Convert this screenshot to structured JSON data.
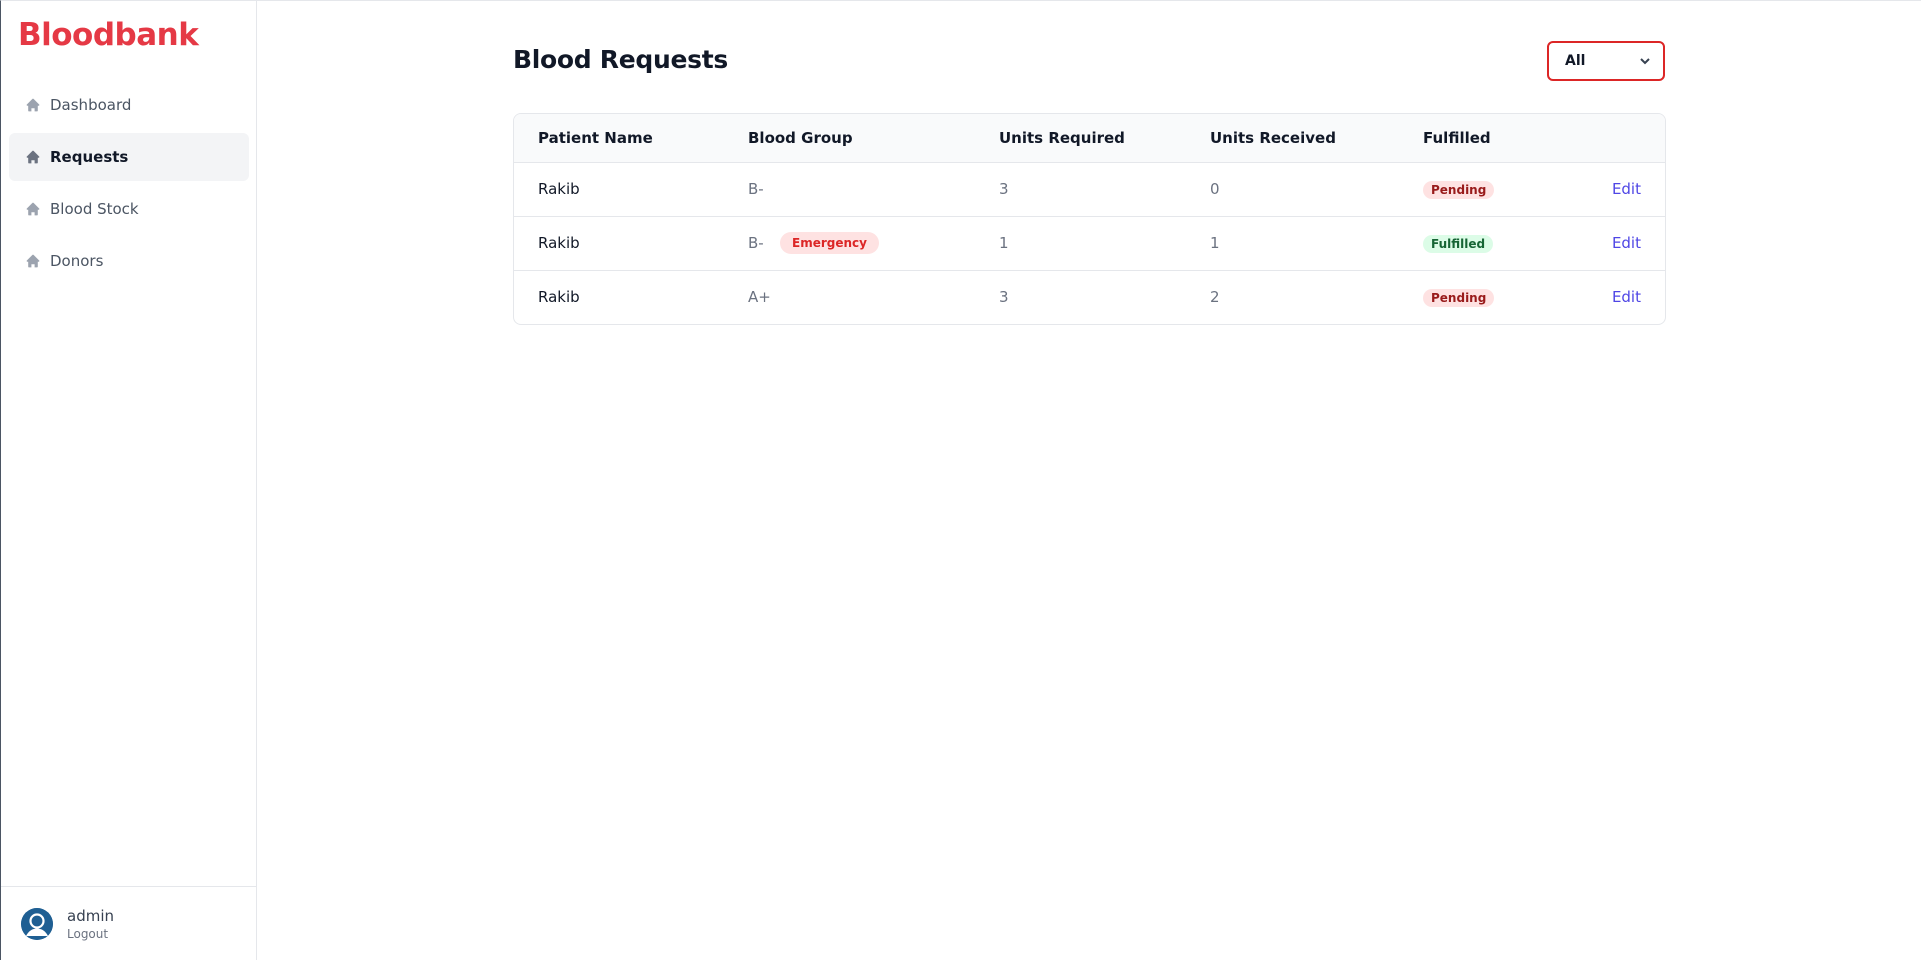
{
  "brand": {
    "name": "Bloodbank",
    "color": "#e53945"
  },
  "sidebar": {
    "items": [
      {
        "label": "Dashboard",
        "icon": "home-icon",
        "active": false
      },
      {
        "label": "Requests",
        "icon": "home-icon",
        "active": true
      },
      {
        "label": "Blood Stock",
        "icon": "home-icon",
        "active": false
      },
      {
        "label": "Donors",
        "icon": "home-icon",
        "active": false
      }
    ]
  },
  "user": {
    "name": "admin",
    "logout_label": "Logout",
    "avatar_color": "#1f5f93"
  },
  "main": {
    "title": "Blood Requests",
    "filter": {
      "selected": "All",
      "icon": "chevron-down-icon",
      "border_color": "#dc2626"
    },
    "table": {
      "headers": [
        "Patient Name",
        "Blood Group",
        "Units Required",
        "Units Received",
        "Fulfilled",
        ""
      ],
      "rows": [
        {
          "patient": "Rakib",
          "blood_group": "B-",
          "emergency": "",
          "units_required": "3",
          "units_received": "0",
          "status": "Pending",
          "status_type": "pending",
          "action": "Edit"
        },
        {
          "patient": "Rakib",
          "blood_group": "B-",
          "emergency": "Emergency",
          "units_required": "1",
          "units_received": "1",
          "status": "Fulfilled",
          "status_type": "fulfilled",
          "action": "Edit"
        },
        {
          "patient": "Rakib",
          "blood_group": "A+",
          "emergency": "",
          "units_required": "3",
          "units_received": "2",
          "status": "Pending",
          "status_type": "pending",
          "action": "Edit"
        }
      ]
    }
  }
}
